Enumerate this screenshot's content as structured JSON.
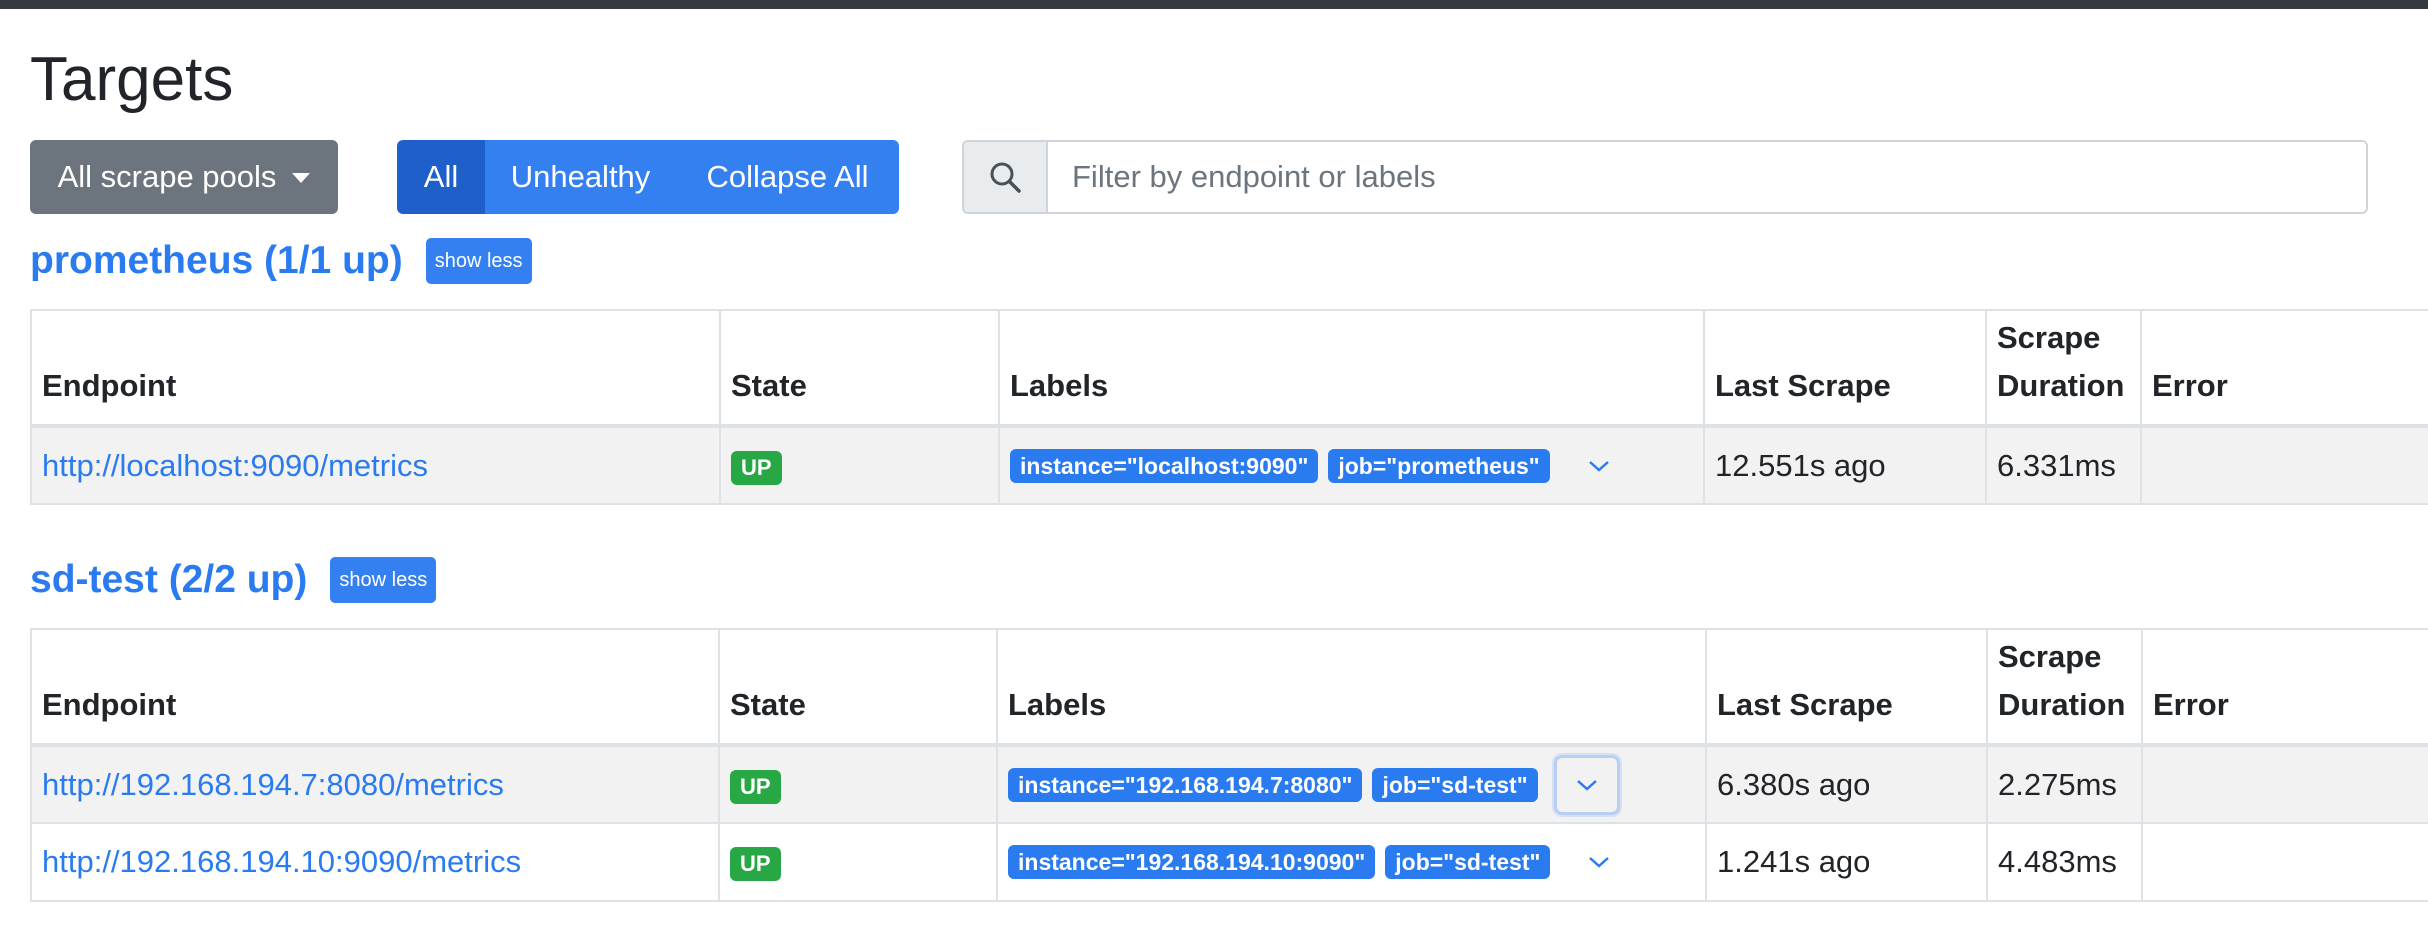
{
  "page": {
    "title": "Targets"
  },
  "controls": {
    "scrape_pools_label": "All scrape pools",
    "filter_buttons": [
      "All",
      "Unhealthy",
      "Collapse All"
    ],
    "active_filter": "All",
    "search_placeholder": "Filter by endpoint or labels"
  },
  "columns": {
    "endpoint": "Endpoint",
    "state": "State",
    "labels": "Labels",
    "last_scrape": "Last Scrape",
    "scrape_duration_1": "Scrape",
    "scrape_duration_2": "Duration",
    "error": "Error"
  },
  "pools": [
    {
      "title": "prometheus (1/1 up)",
      "toggle_label": "show less",
      "targets": [
        {
          "endpoint": "http://localhost:9090/metrics",
          "state": "UP",
          "labels": [
            "instance=\"localhost:9090\"",
            "job=\"prometheus\""
          ],
          "last_scrape": "12.551s ago",
          "scrape_duration": "6.331ms",
          "error": ""
        }
      ]
    },
    {
      "title": "sd-test (2/2 up)",
      "toggle_label": "show less",
      "targets": [
        {
          "endpoint": "http://192.168.194.7:8080/metrics",
          "state": "UP",
          "labels": [
            "instance=\"192.168.194.7:8080\"",
            "job=\"sd-test\""
          ],
          "last_scrape": "6.380s ago",
          "scrape_duration": "2.275ms",
          "error": ""
        },
        {
          "endpoint": "http://192.168.194.10:9090/metrics",
          "state": "UP",
          "labels": [
            "instance=\"192.168.194.10:9090\"",
            "job=\"sd-test\""
          ],
          "last_scrape": "1.241s ago",
          "scrape_duration": "4.483ms",
          "error": ""
        }
      ]
    }
  ],
  "colors": {
    "primary": "#3580f0",
    "active": "#1f5fc9",
    "secondary": "#6c757d",
    "success": "#28a745",
    "link": "#2b7bf0",
    "topbar": "#343a40"
  }
}
